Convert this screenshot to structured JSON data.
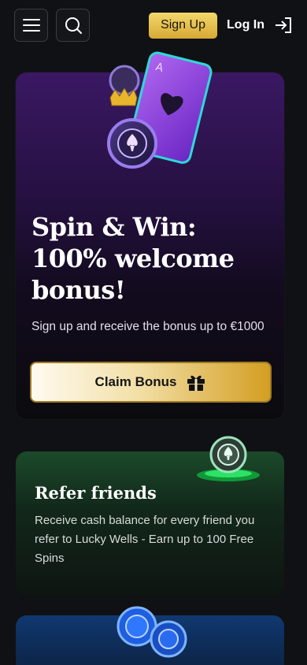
{
  "header": {
    "menu_icon": "hamburger-menu-icon",
    "search_icon": "search-icon",
    "signup_label": "Sign Up",
    "login_label": "Log In",
    "login_icon": "login-arrow-icon"
  },
  "hero": {
    "title_line1": "Spin & Win:",
    "title_line2": "100% welcome",
    "title_line3": "bonus!",
    "subtitle": "Sign up and receive the bonus up to €1000",
    "button_label": "Claim Bonus",
    "button_icon": "gift-icon"
  },
  "refer": {
    "title": "Refer friends",
    "text": "Receive cash balance for every friend you refer to Lucky Wells - Earn up to 100 Free Spins"
  },
  "colors": {
    "accent_gold": "#e6bd4a",
    "background": "#101114",
    "hero_purple": "#3a1863",
    "refer_green": "#1b4a2a",
    "promo_blue": "#103870"
  }
}
